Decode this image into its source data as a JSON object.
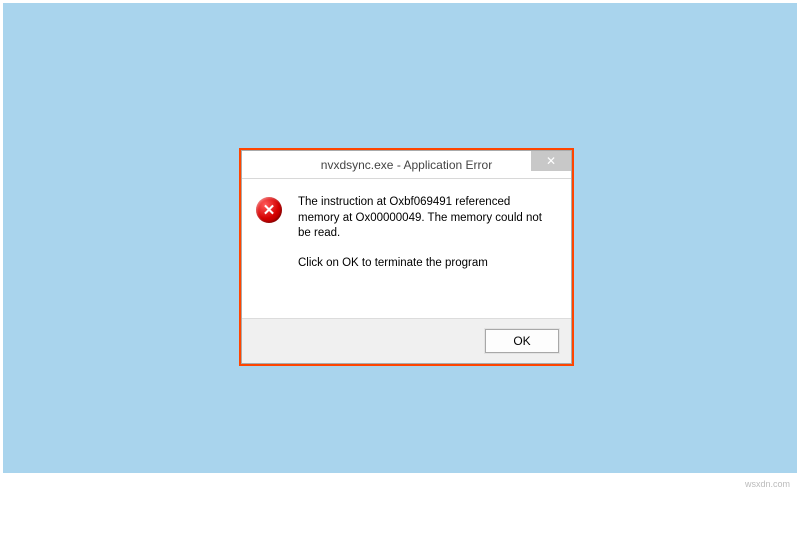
{
  "dialog": {
    "title": "nvxdsync.exe - Application Error",
    "close_glyph": "✕",
    "message_line1": "The instruction at Oxbf069491 referenced memory at Ox00000049. The memory could not be read.",
    "message_line2": "Click on OK to terminate the program",
    "ok_label": "OK",
    "icon_name": "error"
  },
  "watermark": "wsxdn.com"
}
